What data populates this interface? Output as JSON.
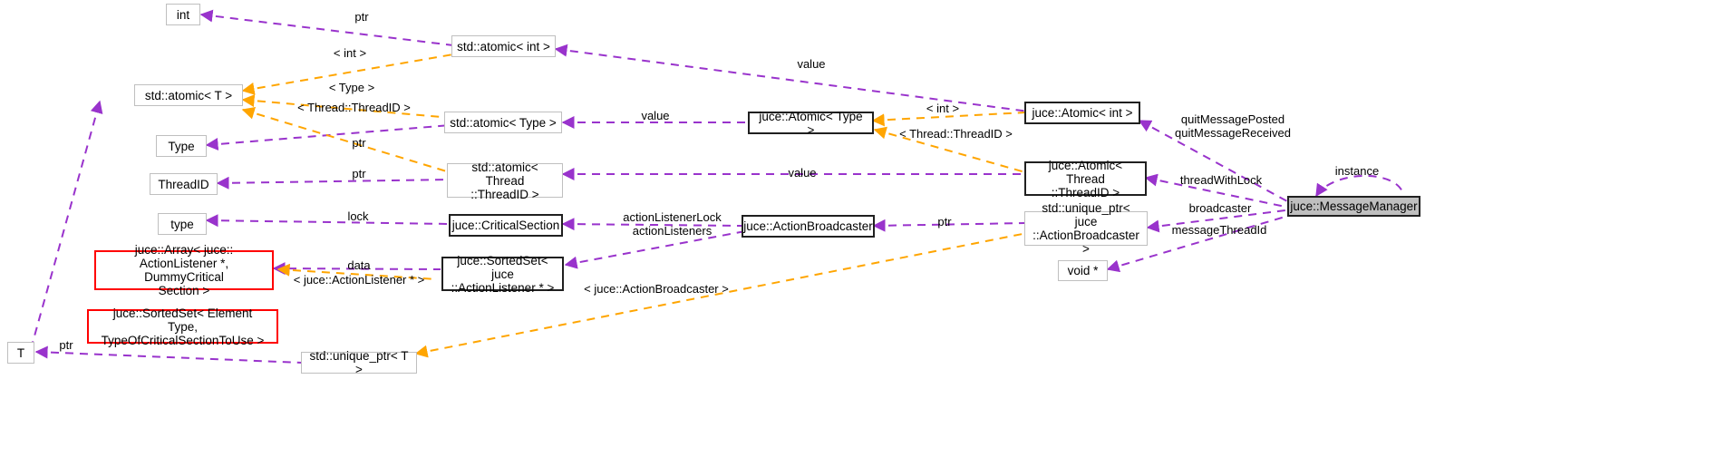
{
  "diagram": {
    "title": "juce::MessageManager",
    "type": "collaboration-diagram",
    "colors": {
      "usage_edge": "#9933cc",
      "template_edge": "#ffa500",
      "node_border": "#bfbfbf",
      "node_border_bold": "#202020",
      "node_border_red": "#ff0000",
      "focus_fill": "#bfbfbf",
      "background": "#ffffff"
    },
    "nodes": [
      {
        "id": "int",
        "label": "int"
      },
      {
        "id": "atomic_T",
        "label": "std::atomic< T >"
      },
      {
        "id": "atomic_int",
        "label": "std::atomic< int >"
      },
      {
        "id": "atomic_Type",
        "label": "std::atomic< Type >"
      },
      {
        "id": "Type",
        "label": "Type"
      },
      {
        "id": "ThreadID",
        "label": "ThreadID"
      },
      {
        "id": "atomic_ThreadID",
        "label": "std::atomic< Thread\n::ThreadID >"
      },
      {
        "id": "type",
        "label": "type"
      },
      {
        "id": "CriticalSection",
        "label": "juce::CriticalSection"
      },
      {
        "id": "juceArray",
        "label": "juce::Array< juce::\nActionListener *, DummyCritical\nSection >"
      },
      {
        "id": "SortedSet_AL",
        "label": "juce::SortedSet< juce\n::ActionListener * >"
      },
      {
        "id": "SortedSet_Element",
        "label": "juce::SortedSet< Element\nType, TypeOfCriticalSectionToUse >"
      },
      {
        "id": "ActionBroadcaster",
        "label": "juce::ActionBroadcaster"
      },
      {
        "id": "juceAtomic_Type",
        "label": "juce::Atomic< Type >"
      },
      {
        "id": "juceAtomic_int",
        "label": "juce::Atomic< int >"
      },
      {
        "id": "juceAtomic_ThreadID",
        "label": "juce::Atomic< Thread\n::ThreadID >"
      },
      {
        "id": "uniqueptr_AB",
        "label": "std::unique_ptr< juce\n::ActionBroadcaster >"
      },
      {
        "id": "voidptr",
        "label": "void *"
      },
      {
        "id": "T",
        "label": "T"
      },
      {
        "id": "uniqueptr_T",
        "label": "std::unique_ptr< T >"
      },
      {
        "id": "MessageManager",
        "label": "juce::MessageManager"
      }
    ],
    "edge_labels": [
      {
        "id": "l_ptr_int",
        "text": "ptr"
      },
      {
        "id": "l_tmpl_int",
        "text": "< int >"
      },
      {
        "id": "l_tmpl_type",
        "text": "< Type >"
      },
      {
        "id": "l_tmpl_threadid",
        "text": "< Thread::ThreadID >"
      },
      {
        "id": "l_ptr_type",
        "text": "ptr"
      },
      {
        "id": "l_ptr_threadid",
        "text": "ptr"
      },
      {
        "id": "l_lock",
        "text": "lock"
      },
      {
        "id": "l_value_int",
        "text": "value"
      },
      {
        "id": "l_value_type",
        "text": "value"
      },
      {
        "id": "l_value_threadid",
        "text": "value"
      },
      {
        "id": "l_tmpl_int2",
        "text": "< int >"
      },
      {
        "id": "l_tmpl_threadid2",
        "text": "< Thread::ThreadID >"
      },
      {
        "id": "l_actionlistener",
        "text": "actionListenerLock\nactionListeners"
      },
      {
        "id": "l_data",
        "text": "data"
      },
      {
        "id": "l_tmpl_al",
        "text": "< juce::ActionListener * >"
      },
      {
        "id": "l_tmpl_ab",
        "text": "< juce::ActionBroadcaster >"
      },
      {
        "id": "l_ptr_ab",
        "text": "ptr"
      },
      {
        "id": "l_quit",
        "text": "quitMessagePosted\nquitMessageReceived"
      },
      {
        "id": "l_threadwithlock",
        "text": "threadWithLock"
      },
      {
        "id": "l_broadcaster",
        "text": "broadcaster"
      },
      {
        "id": "l_messagethreadid",
        "text": "messageThreadId"
      },
      {
        "id": "l_instance",
        "text": "instance"
      },
      {
        "id": "l_ptr_T",
        "text": "ptr"
      }
    ]
  }
}
